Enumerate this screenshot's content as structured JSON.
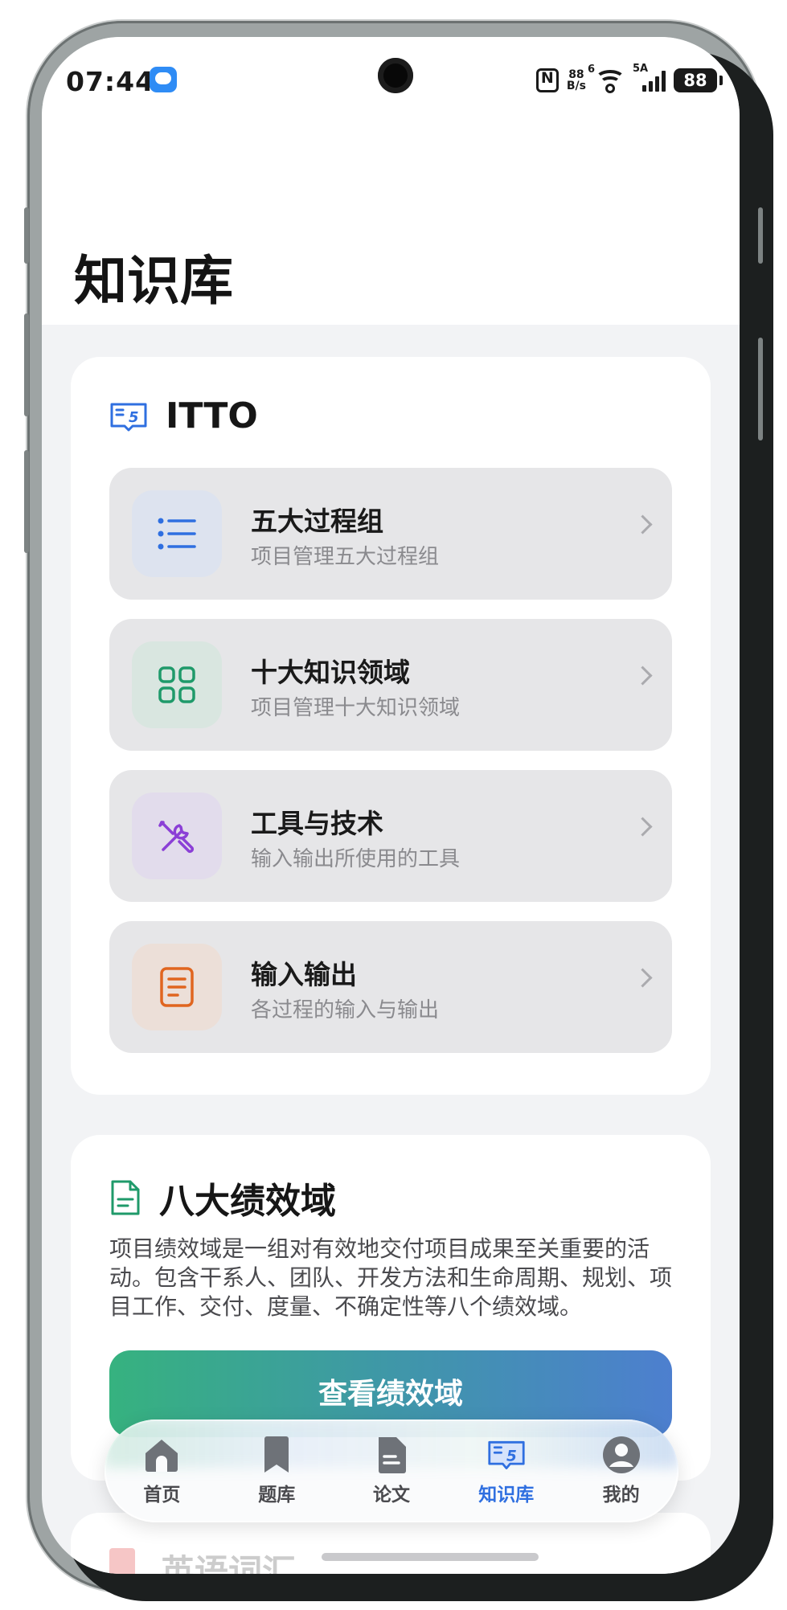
{
  "status_bar": {
    "time": "07:44",
    "net_speed_top": "88",
    "net_speed_bottom": "B/s",
    "wifi_tag": "6",
    "signal_tag": "5A",
    "battery": "88"
  },
  "page": {
    "title": "知识库"
  },
  "itto": {
    "title": "ITTO",
    "items": [
      {
        "title": "五大过程组",
        "subtitle": "项目管理五大过程组",
        "icon": "list-icon",
        "color": "#2f6fe0",
        "bg": "#dde3ef"
      },
      {
        "title": "十大知识领域",
        "subtitle": "项目管理十大知识领域",
        "icon": "grid-icon",
        "color": "#1f9a6a",
        "bg": "#d9e6e0"
      },
      {
        "title": "工具与技术",
        "subtitle": "输入输出所使用的工具",
        "icon": "tools-icon",
        "color": "#8b3fd6",
        "bg": "#e2dcec"
      },
      {
        "title": "输入输出",
        "subtitle": "各过程的输入与输出",
        "icon": "document-icon",
        "color": "#e0651f",
        "bg": "#ecdfd8"
      }
    ]
  },
  "performance": {
    "title": "八大绩效域",
    "description": "项目绩效域是一组对有效地交付项目成果至关重要的活动。包含干系人、团队、开发方法和生命周期、规划、项目工作、交付、度量、不确定性等八个绩效域。",
    "button_label": "查看绩效域"
  },
  "vocab": {
    "title": "英语词汇"
  },
  "bottom_nav": {
    "items": [
      {
        "label": "首页",
        "icon": "home-icon"
      },
      {
        "label": "题库",
        "icon": "bookmark-icon"
      },
      {
        "label": "论文",
        "icon": "paper-icon"
      },
      {
        "label": "知识库",
        "icon": "book-icon",
        "active": true
      },
      {
        "label": "我的",
        "icon": "user-icon"
      }
    ]
  }
}
